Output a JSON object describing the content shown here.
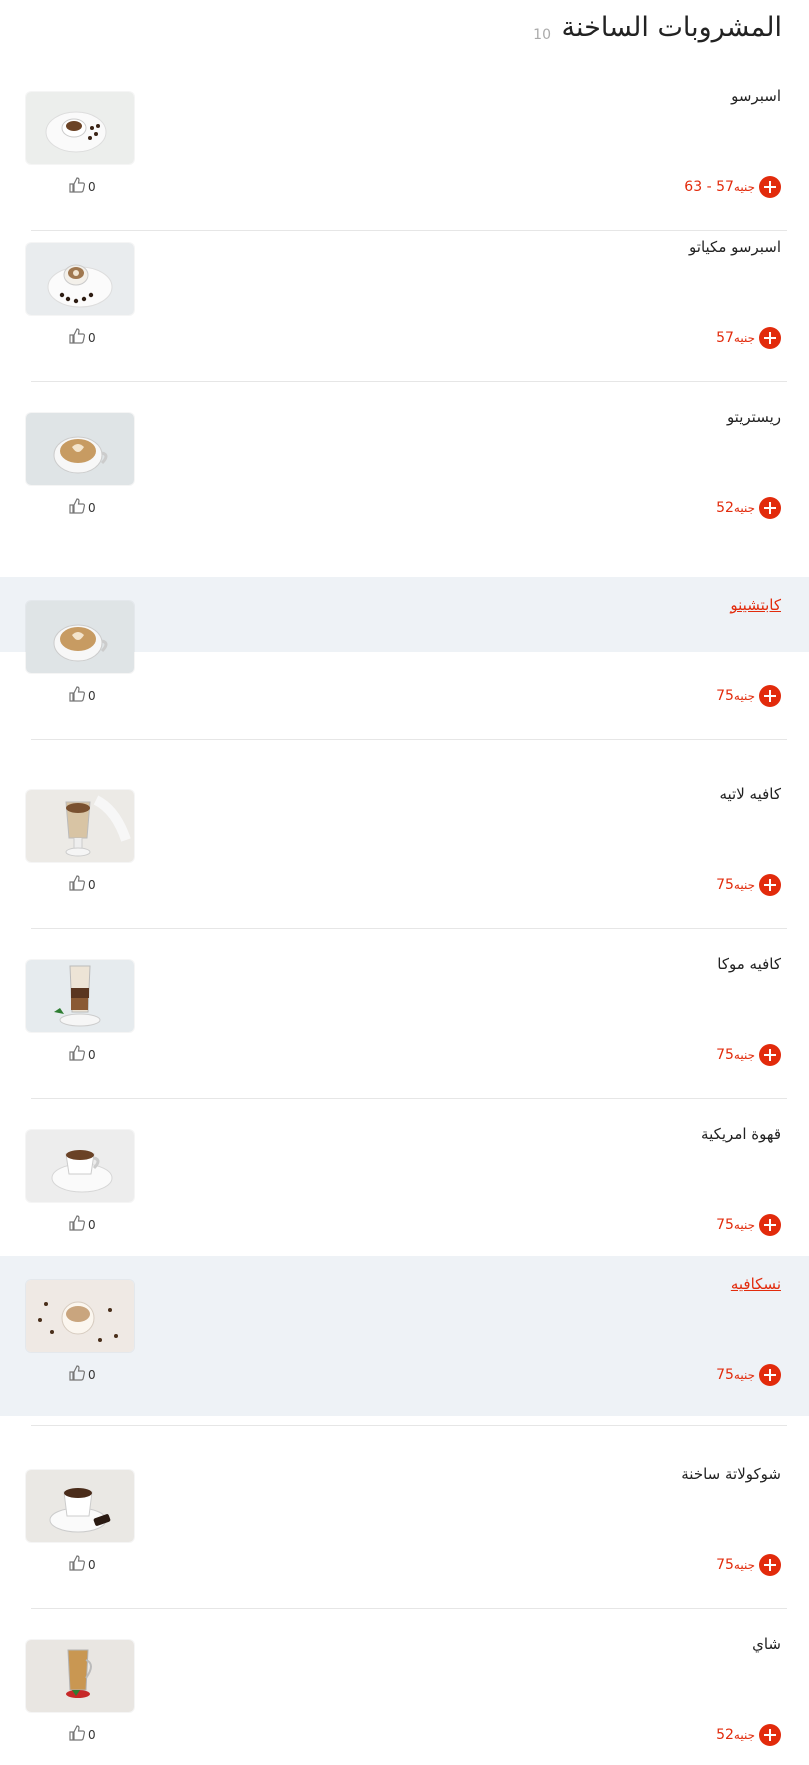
{
  "category": {
    "title": "المشروبات الساخنة",
    "count": "10"
  },
  "colors": {
    "accent": "#e22b0c",
    "highlight": "#eef2f6"
  },
  "items": [
    {
      "name": "اسبرسو",
      "price": "57 - 63",
      "currency": "جنيه",
      "likes": "0",
      "highlighted": false
    },
    {
      "name": "اسبرسو مكياتو",
      "price": "57",
      "currency": "جنيه",
      "likes": "0",
      "highlighted": false
    },
    {
      "name": "ريستريتو",
      "price": "52",
      "currency": "جنيه",
      "likes": "0",
      "highlighted": false
    },
    {
      "name": "كابتشينو",
      "price": "75",
      "currency": "جنيه",
      "likes": "0",
      "highlighted": true
    },
    {
      "name": "كافيه لاتيه",
      "price": "75",
      "currency": "جنيه",
      "likes": "0",
      "highlighted": false
    },
    {
      "name": "كافيه موكا",
      "price": "75",
      "currency": "جنيه",
      "likes": "0",
      "highlighted": false
    },
    {
      "name": "قهوة امريكية",
      "price": "75",
      "currency": "جنيه",
      "likes": "0",
      "highlighted": false
    },
    {
      "name": "نسكافيه",
      "price": "75",
      "currency": "جنيه",
      "likes": "0",
      "highlighted": true
    },
    {
      "name": "شوكولاتة ساخنة",
      "price": "75",
      "currency": "جنيه",
      "likes": "0",
      "highlighted": false
    },
    {
      "name": "شاي",
      "price": "52",
      "currency": "جنيه",
      "likes": "0",
      "highlighted": false
    }
  ],
  "icons": {
    "like": "thumbs-up-icon",
    "add": "plus-circle-icon"
  }
}
